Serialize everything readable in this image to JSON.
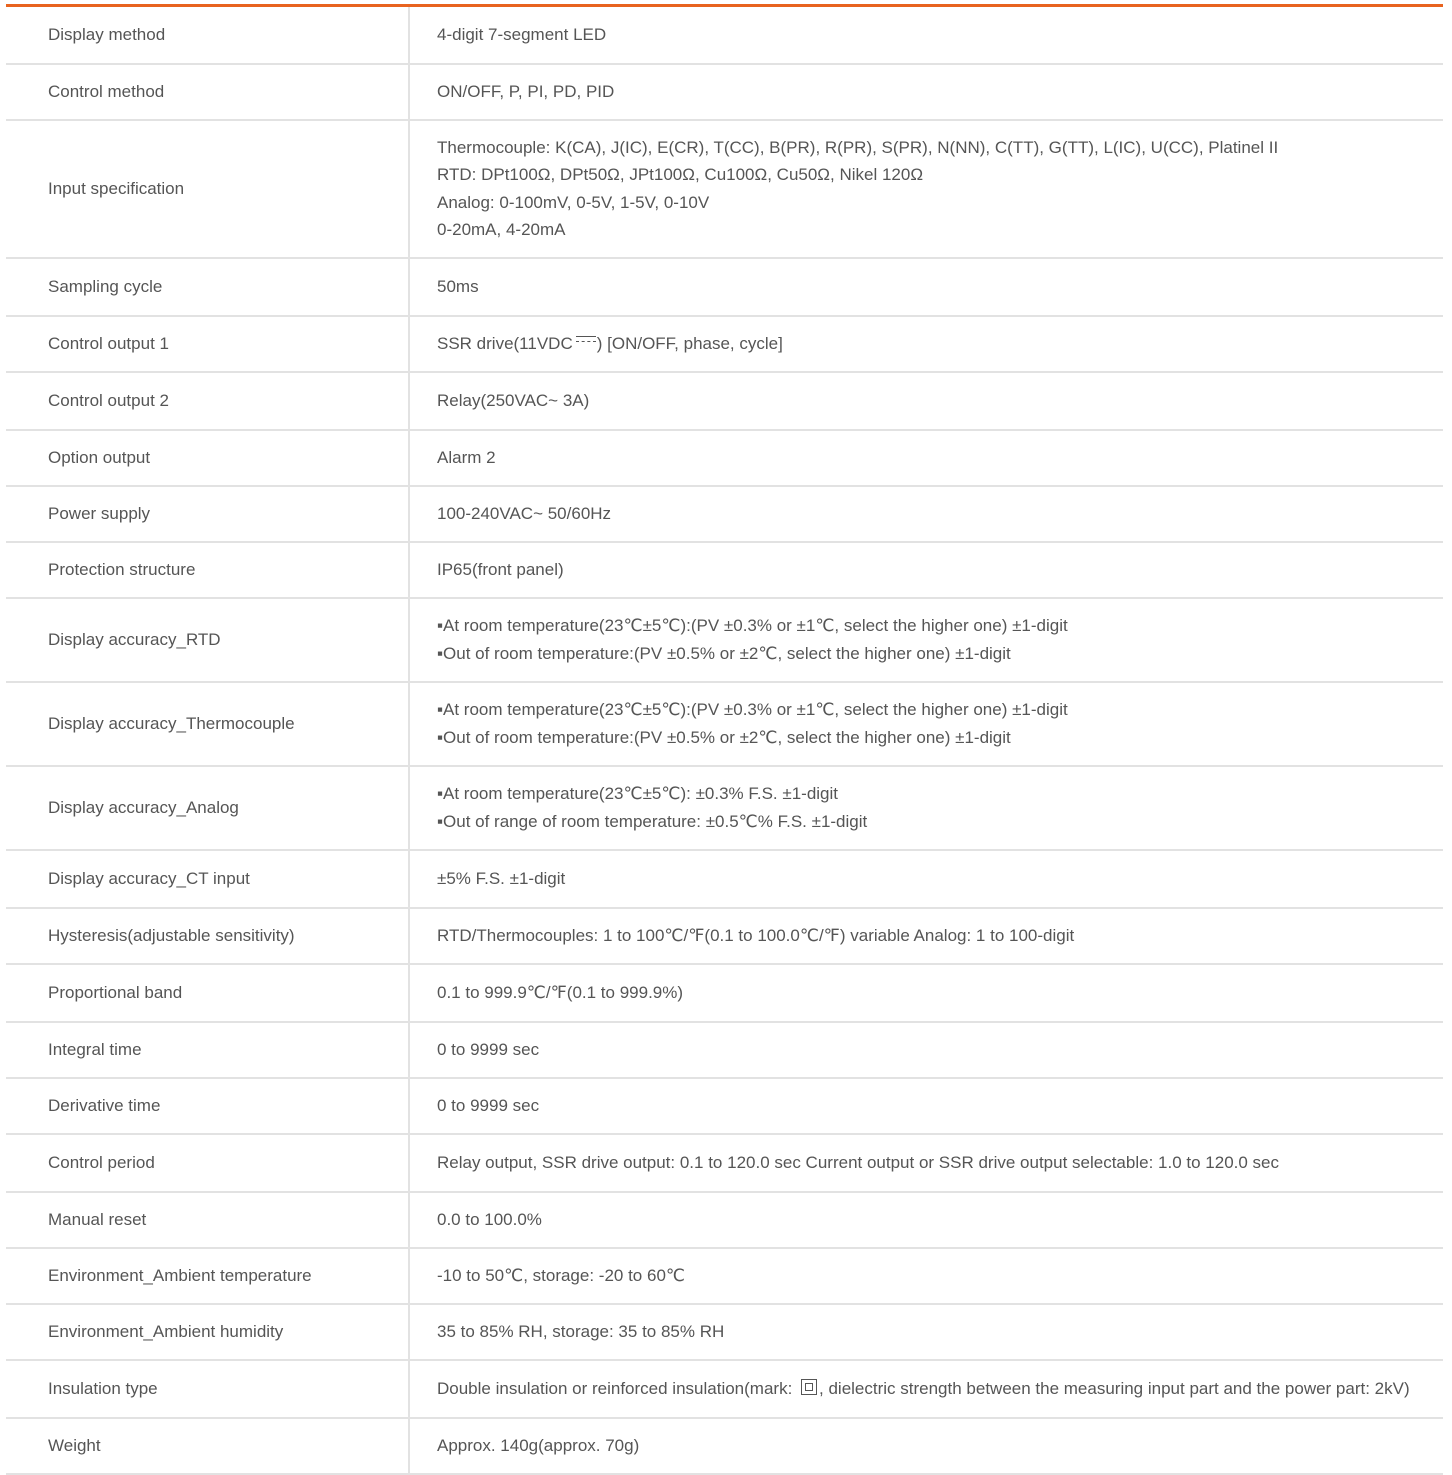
{
  "specs": [
    {
      "label": "Display method",
      "lines": [
        "4-digit 7-segment LED"
      ]
    },
    {
      "label": "Control method",
      "lines": [
        "ON/OFF, P, PI, PD, PID"
      ]
    },
    {
      "label": "Input specification",
      "lines": [
        "Thermocouple: K(CA), J(IC), E(CR), T(CC), B(PR), R(PR), S(PR), N(NN), C(TT), G(TT), L(IC), U(CC), Platinel II",
        "RTD: DPt100Ω, DPt50Ω, JPt100Ω, Cu100Ω, Cu50Ω, Nikel 120Ω",
        "Analog: 0-100mV, 0-5V, 1-5V, 0-10V",
        "0-20mA, 4-20mA"
      ]
    },
    {
      "label": "Sampling cycle",
      "lines": [
        "50ms"
      ]
    },
    {
      "label": "Control output 1",
      "pre": "SSR drive(11VDC",
      "symbol": "dc-symbol",
      "post": ") [ON/OFF, phase, cycle]"
    },
    {
      "label": "Control output 2",
      "lines": [
        "Relay(250VAC~ 3A)"
      ]
    },
    {
      "label": "Option output",
      "lines": [
        "Alarm 2"
      ]
    },
    {
      "label": "Power supply",
      "lines": [
        "100-240VAC~ 50/60Hz"
      ]
    },
    {
      "label": "Protection structure",
      "lines": [
        "IP65(front panel)"
      ]
    },
    {
      "label": "Display accuracy_RTD",
      "lines": [
        "▪At room temperature(23℃±5℃):(PV ±0.3% or ±1℃, select the higher one) ±1-digit",
        "▪Out of room temperature:(PV ±0.5% or ±2℃, select the higher one) ±1-digit"
      ]
    },
    {
      "label": "Display accuracy_Thermocouple",
      "lines": [
        "▪At room temperature(23℃±5℃):(PV ±0.3% or ±1℃, select the higher one) ±1-digit",
        "▪Out of room temperature:(PV ±0.5% or ±2℃, select the higher one) ±1-digit"
      ]
    },
    {
      "label": "Display accuracy_Analog",
      "lines": [
        "▪At room temperature(23℃±5℃): ±0.3% F.S. ±1-digit",
        "▪Out of range of room temperature: ±0.5℃% F.S. ±1-digit"
      ]
    },
    {
      "label": "Display accuracy_CT input",
      "lines": [
        "±5% F.S. ±1-digit"
      ]
    },
    {
      "label": "Hysteresis(adjustable sensitivity)",
      "lines": [
        "RTD/Thermocouples: 1 to 100℃/℉(0.1 to 100.0℃/℉) variable Analog: 1 to 100-digit"
      ]
    },
    {
      "label": "Proportional band",
      "lines": [
        "0.1 to 999.9℃/℉(0.1 to 999.9%)"
      ]
    },
    {
      "label": "Integral time",
      "lines": [
        "0 to 9999 sec"
      ]
    },
    {
      "label": "Derivative time",
      "lines": [
        "0 to 9999 sec"
      ]
    },
    {
      "label": "Control period",
      "lines": [
        "Relay output, SSR drive output: 0.1 to 120.0 sec Current output or SSR drive output selectable: 1.0 to 120.0 sec"
      ]
    },
    {
      "label": "Manual reset",
      "lines": [
        "0.0 to 100.0%"
      ]
    },
    {
      "label": "Environment_Ambient temperature",
      "lines": [
        "-10 to 50℃, storage: -20 to 60℃"
      ]
    },
    {
      "label": "Environment_Ambient humidity",
      "lines": [
        "35 to 85% RH, storage: 35 to 85% RH"
      ]
    },
    {
      "label": "Insulation type",
      "pre": "Double insulation or reinforced insulation(mark: ",
      "symbol": "double-insulation-mark",
      "post": ", dielectric strength between the measuring input part and the power part: 2kV)"
    },
    {
      "label": "Weight",
      "lines": [
        "Approx. 140g(approx. 70g)"
      ]
    }
  ]
}
